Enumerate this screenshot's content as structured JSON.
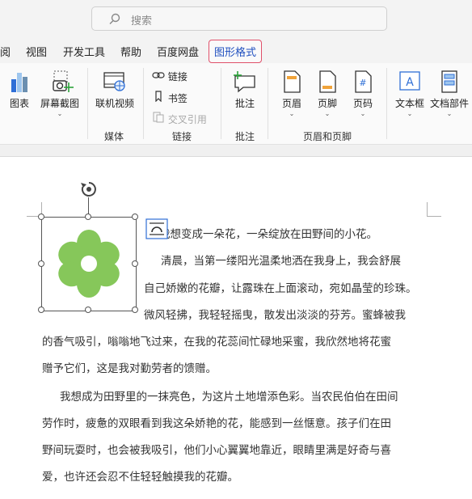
{
  "search": {
    "placeholder": "搜索"
  },
  "tabs": [
    {
      "label": "阅"
    },
    {
      "label": "视图"
    },
    {
      "label": "开发工具"
    },
    {
      "label": "帮助"
    },
    {
      "label": "百度网盘"
    },
    {
      "label": "图形格式"
    }
  ],
  "ribbon": {
    "chart": "图表",
    "screenshot": "屏幕截图",
    "online_video": "联机视频",
    "link": "链接",
    "bookmark": "书签",
    "cross_reference": "交叉引用",
    "comment": "批注",
    "header": "页眉",
    "footer": "页脚",
    "page_number": "页码",
    "text_box": "文本框",
    "doc_parts": "文档部件",
    "groups": {
      "media": "媒体",
      "links": "链接",
      "comments": "批注",
      "header_footer": "页眉和页脚"
    }
  },
  "document": {
    "lines": [
      "我想变成一朵花，一朵绽放在田野间的小花。",
      "清晨，当第一缕阳光温柔地洒在我身上，我会舒展",
      "自己娇嫩的花瓣，让露珠在上面滚动，宛如晶莹的珍珠。",
      "微风轻拂，我轻轻摇曳，散发出淡淡的芬芳。蜜蜂被我",
      "的香气吸引，嗡嗡地飞过来，在我的花蕊间忙碌地采蜜，我欣然地将花蜜",
      "赠予它们，这是我对勤劳者的馈赠。",
      "我想成为田野里的一抹亮色，为这片土地增添色彩。当农民伯伯在田间",
      "劳作时，疲惫的双眼看到我这朵娇艳的花，能感到一丝惬意。孩子们在田",
      "野间玩耍时，也会被我吸引，他们小心翼翼地靠近，眼睛里满是好奇与喜",
      "爱，也许还会忍不住轻轻触摸我的花瓣。"
    ]
  },
  "colors": {
    "flower": "#86c75a",
    "active_tab_border": "#e0506a",
    "accent": "#1f6fd1"
  }
}
